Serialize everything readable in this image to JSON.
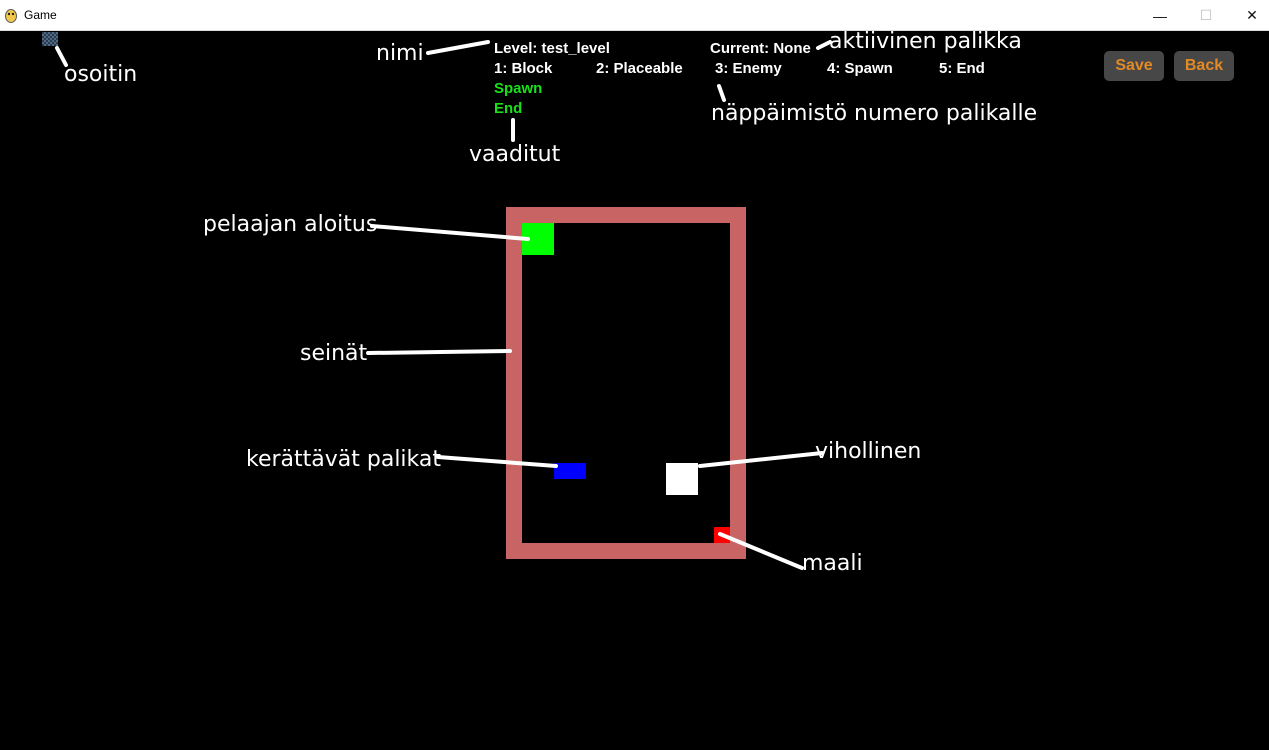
{
  "window": {
    "title": "Game",
    "minimize_glyph": "—",
    "maximize_glyph": "☐",
    "close_glyph": "✕"
  },
  "hud": {
    "level_label": "Level: test_level",
    "current_label": "Current: None",
    "palette": [
      {
        "label": "1: Block"
      },
      {
        "label": "2: Placeable"
      },
      {
        "label": "3: Enemy"
      },
      {
        "label": "4: Spawn"
      },
      {
        "label": "5: End"
      }
    ],
    "required": [
      "Spawn",
      "End"
    ]
  },
  "buttons": {
    "save_label": "Save",
    "back_label": "Back"
  },
  "annotations": {
    "cursor": "osoitin",
    "name": "nimi",
    "active_block": "aktiivinen palikka",
    "keyboard_numbers": "näppäimistö numero palikalle",
    "required": "vaaditut",
    "player_start": "pelaajan aloitus",
    "walls": "seinät",
    "collectibles": "kerättävät palikat",
    "enemy": "vihollinen",
    "goal": "maali"
  },
  "colors": {
    "wall": "#c86464",
    "spawn": "#00ff00",
    "placeable": "#0000ff",
    "enemy": "#ffffff",
    "end": "#ff0000",
    "required_text": "#1ae01a",
    "button_bg": "#474747",
    "button_text": "#e28a26"
  }
}
